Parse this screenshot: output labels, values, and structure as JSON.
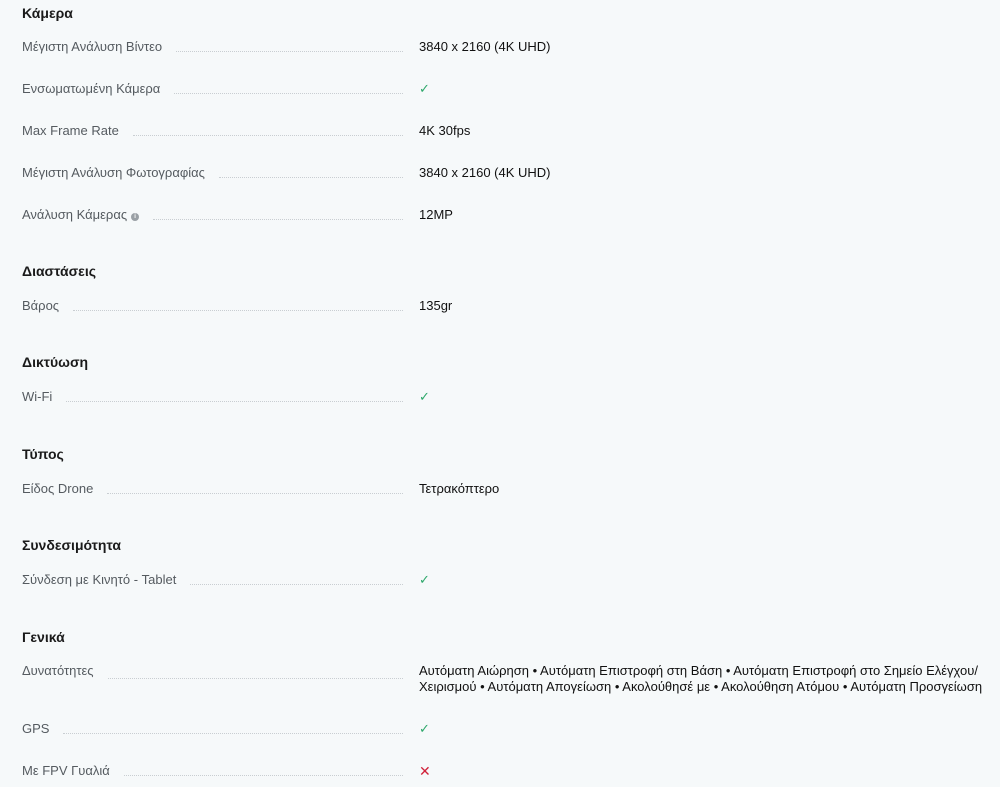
{
  "sections": [
    {
      "title": "Κάμερα",
      "rows": [
        {
          "label": "Μέγιστη Ανάλυση Βίντεο",
          "value": "3840 x 2160 (4K UHD)"
        },
        {
          "label": "Ενσωματωμένη Κάμερα",
          "value": "✓"
        },
        {
          "label": "Max Frame Rate",
          "value": "4K 30fps"
        },
        {
          "label": "Μέγιστη Ανάλυση Φωτογραφίας",
          "value": "3840 x 2160 (4K UHD)"
        },
        {
          "label": "Ανάλυση Κάμερας",
          "value": "12MP",
          "info_icon": "info-icon"
        }
      ]
    },
    {
      "title": "Διαστάσεις",
      "rows": [
        {
          "label": "Βάρος",
          "value": "135gr"
        }
      ]
    },
    {
      "title": "Δικτύωση",
      "rows": [
        {
          "label": "Wi-Fi",
          "value": "✓"
        }
      ]
    },
    {
      "title": "Τύπος",
      "rows": [
        {
          "label": "Είδος Drone",
          "value": "Τετρακόπτερο"
        }
      ]
    },
    {
      "title": "Συνδεσιμότητα",
      "rows": [
        {
          "label": "Σύνδεση με Κινητό - Tablet",
          "value": "✓"
        }
      ]
    },
    {
      "title": "Γενικά",
      "rows": [
        {
          "label": "Δυνατότητες",
          "value_line1": "Αυτόματη Αιώρηση • Αυτόματη Επιστροφή στη Βάση • Αυτόματη Επιστροφή στο Σημείο Ελέγχου/",
          "value_line2": "Χειρισμού • Αυτόματη Απογείωση • Ακολούθησέ με • Ακολούθηση Ατόμου • Αυτόματη Προσγείωση"
        },
        {
          "label": "GPS",
          "value": "✓"
        },
        {
          "label": "Με FPV Γυαλιά",
          "value": "✕"
        }
      ]
    }
  ],
  "colors": {
    "check": "#2ea86b",
    "cross": "#d0213a",
    "background": "#f6f9fa"
  }
}
